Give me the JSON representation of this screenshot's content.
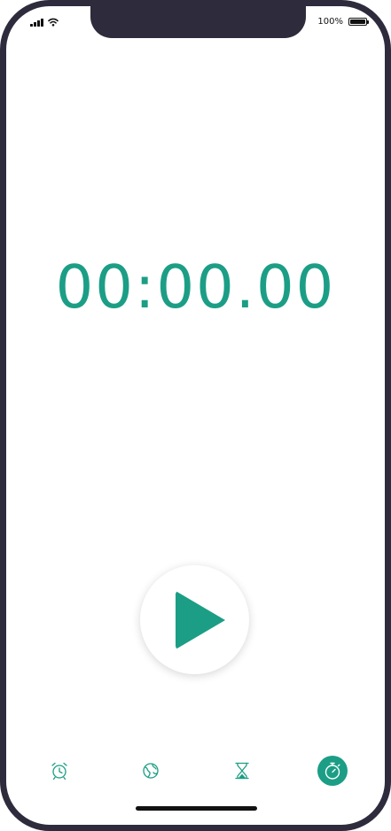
{
  "status_bar": {
    "battery_text": "100%"
  },
  "timer": {
    "display": "00:00.00"
  },
  "controls": {
    "play_icon": "play-icon"
  },
  "tabs": [
    {
      "icon": "alarm-clock-icon",
      "active": false
    },
    {
      "icon": "world-clock-icon",
      "active": false
    },
    {
      "icon": "hourglass-icon",
      "active": false
    },
    {
      "icon": "stopwatch-icon",
      "active": true
    }
  ],
  "colors": {
    "accent": "#1b9e85",
    "frame": "#2d2b3c"
  }
}
